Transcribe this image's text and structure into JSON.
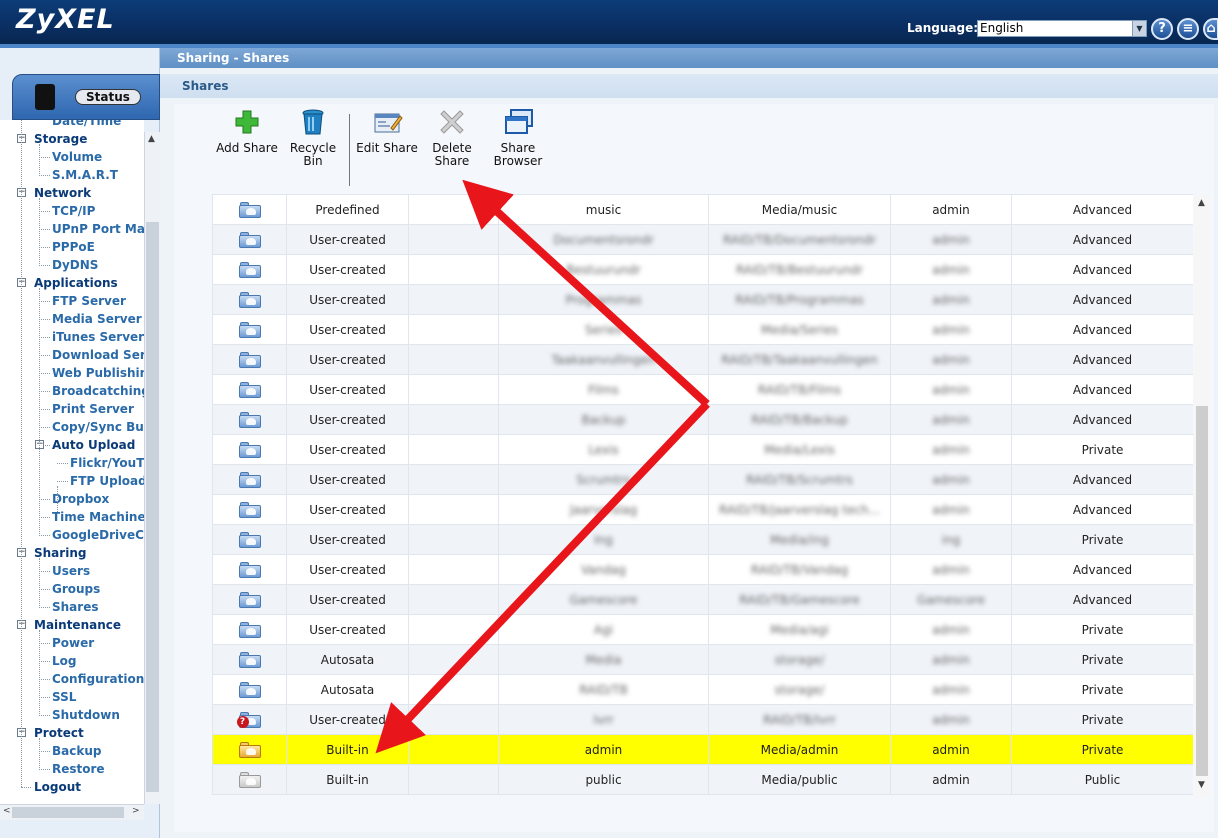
{
  "header": {
    "logo": "ZyXEL",
    "language_label": "Language:",
    "language_value": "English",
    "buttons": [
      "help-icon",
      "notes-icon",
      "home-icon"
    ]
  },
  "nav": {
    "status_tab": "Status",
    "partial_item": "Date/Time",
    "groups": [
      {
        "label": "Storage",
        "items": [
          "Volume",
          "S.M.A.R.T"
        ]
      },
      {
        "label": "Network",
        "items": [
          "TCP/IP",
          "UPnP Port Map",
          "PPPoE",
          "DyDNS"
        ]
      },
      {
        "label": "Applications",
        "items": [
          "FTP Server",
          "Media Server",
          "iTunes Server",
          "Download Serv",
          "Web Publishin",
          "Broadcatching",
          "Print Server",
          "Copy/Sync Bu",
          "Auto Upload",
          "Flickr/YouT",
          "FTP Upload",
          "Dropbox",
          "Time Machine",
          "GoogleDriveCl"
        ]
      },
      {
        "label": "Sharing",
        "items": [
          "Users",
          "Groups",
          "Shares"
        ]
      },
      {
        "label": "Maintenance",
        "items": [
          "Power",
          "Log",
          "Configuration",
          "SSL",
          "Shutdown"
        ]
      },
      {
        "label": "Protect",
        "items": [
          "Backup",
          "Restore"
        ]
      },
      {
        "label": "Logout",
        "items": []
      }
    ]
  },
  "breadcrumb": "Sharing - Shares",
  "section_title": "Shares",
  "toolbar": {
    "add_share": "Add Share",
    "recycle_bin": "Recycle Bin",
    "edit_share": "Edit Share",
    "delete_share": "Delete Share",
    "share_browser": "Share Browser"
  },
  "shares": [
    {
      "type": "Predefined",
      "name": "music",
      "path": "Media/music",
      "owner": "admin",
      "permission": "Advanced",
      "blur": false,
      "icon": "share-folder-icon"
    },
    {
      "type": "User-created",
      "name": "Documentsrondr",
      "path": "RAID/TB/Documentsrondr",
      "owner": "admin",
      "permission": "Advanced",
      "blur": true,
      "icon": "share-folder-icon"
    },
    {
      "type": "User-created",
      "name": "Bestuurundr",
      "path": "RAID/TB/Bestuurundr",
      "owner": "admin",
      "permission": "Advanced",
      "blur": true,
      "icon": "share-folder-icon"
    },
    {
      "type": "User-created",
      "name": "Programmas",
      "path": "RAID/TB/Programmas",
      "owner": "admin",
      "permission": "Advanced",
      "blur": true,
      "icon": "share-folder-icon"
    },
    {
      "type": "User-created",
      "name": "Series",
      "path": "Media/Series",
      "owner": "admin",
      "permission": "Advanced",
      "blur": true,
      "icon": "share-folder-icon"
    },
    {
      "type": "User-created",
      "name": "Taakaanvullingen",
      "path": "RAID/TB/Taakaanvullingen",
      "owner": "admin",
      "permission": "Advanced",
      "blur": true,
      "icon": "share-folder-icon"
    },
    {
      "type": "User-created",
      "name": "Films",
      "path": "RAID/TB/Films",
      "owner": "admin",
      "permission": "Advanced",
      "blur": true,
      "icon": "share-folder-icon"
    },
    {
      "type": "User-created",
      "name": "Backup",
      "path": "RAID/TB/Backup",
      "owner": "admin",
      "permission": "Advanced",
      "blur": true,
      "icon": "share-folder-icon"
    },
    {
      "type": "User-created",
      "name": "Lexis",
      "path": "Media/Lexis",
      "owner": "admin",
      "permission": "Private",
      "blur": true,
      "icon": "share-folder-icon"
    },
    {
      "type": "User-created",
      "name": "Scrumtrs",
      "path": "RAID/TB/Scrumtrs",
      "owner": "admin",
      "permission": "Advanced",
      "blur": true,
      "icon": "share-folder-icon"
    },
    {
      "type": "User-created",
      "name": "Jaarverslag",
      "path": "RAID/TB/jaarverslag tech...",
      "owner": "admin",
      "permission": "Advanced",
      "blur": true,
      "icon": "share-folder-icon"
    },
    {
      "type": "User-created",
      "name": "Ing",
      "path": "Media/ing",
      "owner": "ing",
      "permission": "Private",
      "blur": true,
      "icon": "share-folder-icon"
    },
    {
      "type": "User-created",
      "name": "Vandag",
      "path": "RAID/TB/Vandag",
      "owner": "admin",
      "permission": "Advanced",
      "blur": true,
      "icon": "share-folder-icon"
    },
    {
      "type": "User-created",
      "name": "Gamescore",
      "path": "RAID/TB/Gamescore",
      "owner": "Gamescore",
      "permission": "Advanced",
      "blur": true,
      "icon": "share-folder-icon"
    },
    {
      "type": "User-created",
      "name": "Agi",
      "path": "Media/agi",
      "owner": "admin",
      "permission": "Private",
      "blur": true,
      "icon": "share-folder-icon"
    },
    {
      "type": "Autosata",
      "name": "Media",
      "path": "storage/",
      "owner": "admin",
      "permission": "Private",
      "blur": true,
      "icon": "share-folder-icon"
    },
    {
      "type": "Autosata",
      "name": "RAID/TB",
      "path": "storage/",
      "owner": "admin",
      "permission": "Private",
      "blur": true,
      "icon": "share-folder-icon"
    },
    {
      "type": "User-created",
      "name": "Ivrr",
      "path": "RAID/TB/Ivrr",
      "owner": "admin",
      "permission": "Private",
      "blur": true,
      "icon": "missing-share-icon"
    },
    {
      "type": "Built-in",
      "name": "admin",
      "path": "Media/admin",
      "owner": "admin",
      "permission": "Private",
      "blur": false,
      "highlight": true,
      "icon": "builtin-share-icon"
    },
    {
      "type": "Built-in",
      "name": "public",
      "path": "Media/public",
      "owner": "admin",
      "permission": "Public",
      "blur": false,
      "icon": "public-share-icon"
    }
  ],
  "colors": {
    "highlight": "#ffff00",
    "arrow": "#e8151b",
    "header": "#0a2f63"
  }
}
